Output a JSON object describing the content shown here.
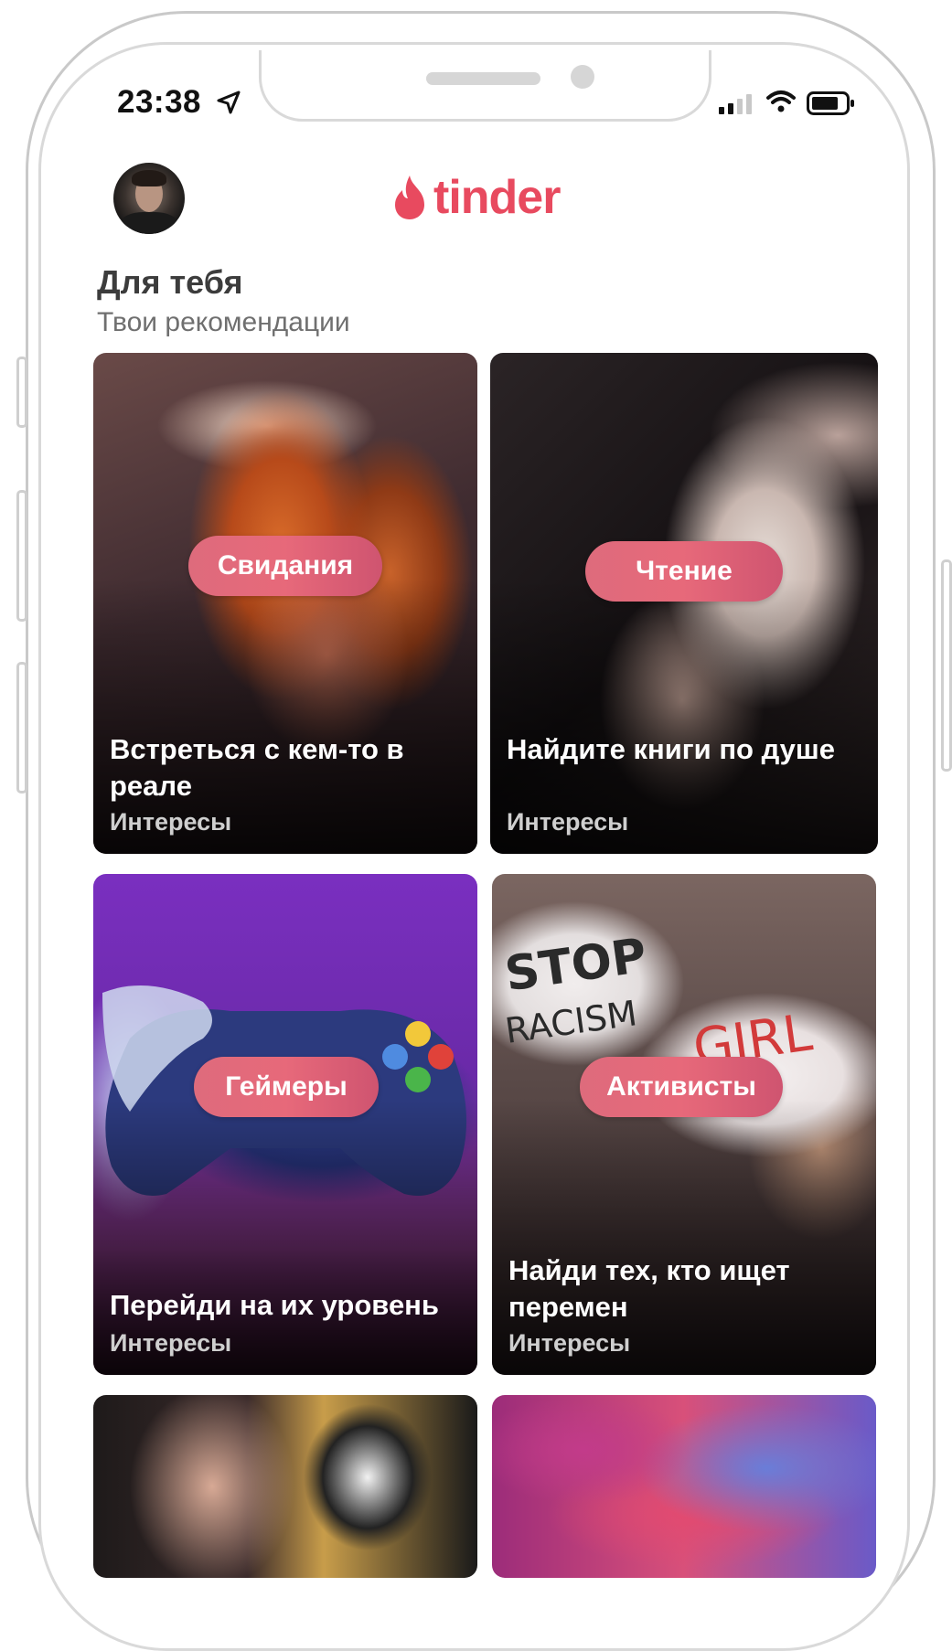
{
  "status": {
    "time": "23:38"
  },
  "header": {
    "logo_text": "tinder"
  },
  "section": {
    "title": "Для тебя",
    "subtitle": "Твои рекомендации"
  },
  "cards": [
    {
      "pill": "Свидания",
      "title": "Встреться с кем-то в реале",
      "tag": "Интересы"
    },
    {
      "pill": "Чтение",
      "title": "Найдите книги по душе",
      "tag": "Интересы"
    },
    {
      "pill": "Геймеры",
      "title": "Перейди на их уровень",
      "tag": "Интересы"
    },
    {
      "pill": "Активисты",
      "title": "Найди тех, кто ищет перемен",
      "tag": "Интересы"
    }
  ],
  "colors": {
    "brand": "#e84a5f",
    "pill": "#e06a7b"
  }
}
